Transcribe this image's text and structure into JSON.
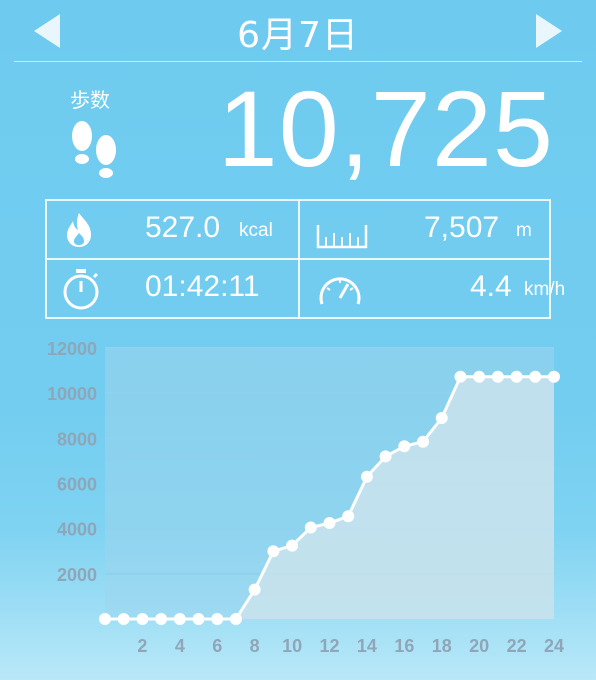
{
  "header": {
    "date": "6月7日",
    "prev_icon": "left-triangle-icon",
    "next_icon": "right-triangle-icon"
  },
  "steps": {
    "label": "歩数",
    "value": "10,725",
    "icon": "footprints-icon"
  },
  "stats": {
    "calories": {
      "value": "527.0",
      "unit": "kcal",
      "icon": "flame-icon"
    },
    "distance": {
      "value": "7,507",
      "unit": "m",
      "icon": "ruler-icon"
    },
    "time": {
      "value": "01:42:11",
      "icon": "stopwatch-icon"
    },
    "speed": {
      "value": "4.4",
      "unit": "km/h",
      "icon": "speedometer-icon"
    }
  },
  "chart_data": {
    "type": "line",
    "x": [
      0,
      1,
      2,
      3,
      4,
      5,
      6,
      7,
      8,
      9,
      10,
      11,
      12,
      13,
      14,
      15,
      16,
      17,
      18,
      19,
      20,
      21,
      22,
      23,
      24
    ],
    "values": [
      0,
      0,
      0,
      0,
      0,
      0,
      0,
      0,
      1300,
      3000,
      3250,
      4050,
      4250,
      4550,
      6300,
      7200,
      7650,
      7850,
      8900,
      10725,
      10725,
      10725,
      10725,
      10725,
      10725
    ],
    "x_tick_labels": [
      "2",
      "4",
      "6",
      "8",
      "10",
      "12",
      "14",
      "16",
      "18",
      "20",
      "22",
      "24"
    ],
    "y_tick_labels": [
      "2000",
      "4000",
      "6000",
      "8000",
      "10000",
      "12000"
    ],
    "y_ticks": [
      2000,
      4000,
      6000,
      8000,
      10000,
      12000
    ],
    "x_ticks": [
      2,
      4,
      6,
      8,
      10,
      12,
      14,
      16,
      18,
      20,
      22,
      24
    ],
    "xlim": [
      0,
      24
    ],
    "ylim": [
      0,
      12000
    ],
    "grid": true,
    "colors": {
      "line": "#ffffff",
      "fill": "#c9e3ec",
      "grid": "#8fd2ef",
      "tick": "#8fa6b8"
    }
  }
}
